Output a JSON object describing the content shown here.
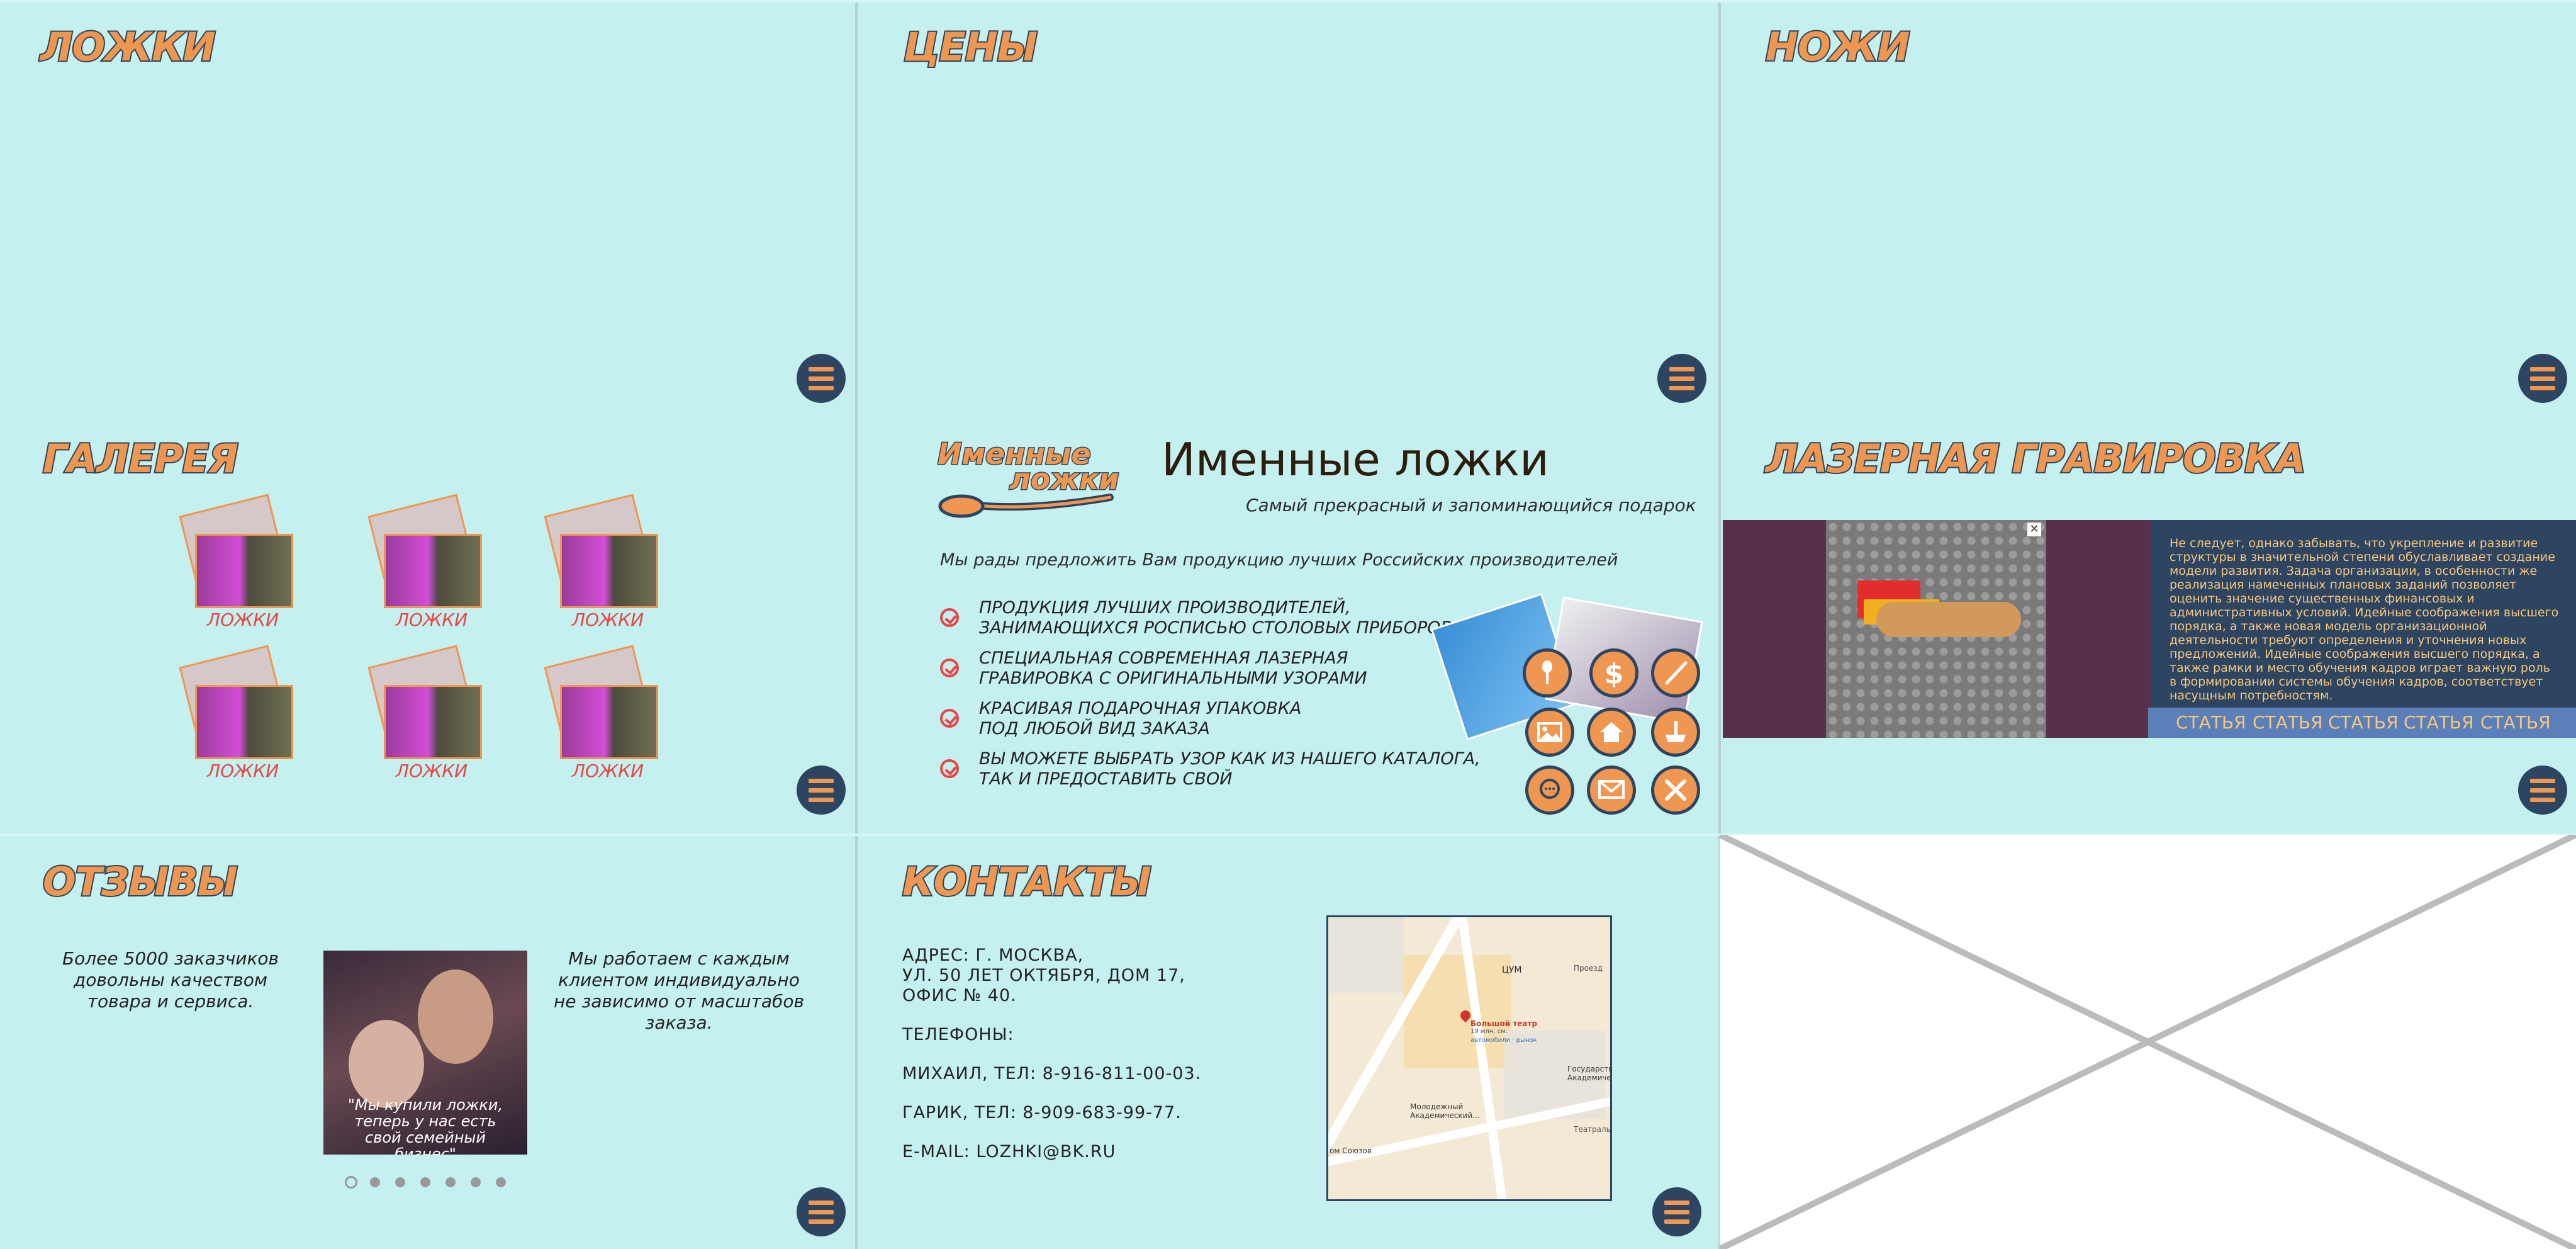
{
  "panels": {
    "spoons": {
      "title": "ЛОЖКИ"
    },
    "prices": {
      "title": "ЦЕНЫ"
    },
    "knives": {
      "title": "НОЖИ"
    },
    "gallery": {
      "title": "ГАЛЕРЕЯ",
      "items": [
        {
          "label": "ЛОЖКИ"
        },
        {
          "label": "ЛОЖКИ"
        },
        {
          "label": "ЛОЖКИ"
        },
        {
          "label": "ЛОЖКИ"
        },
        {
          "label": "ЛОЖКИ"
        },
        {
          "label": "ЛОЖКИ"
        }
      ]
    },
    "promo": {
      "logo_line1": "Именные",
      "logo_line2": "ложки",
      "heading": "Именные ложки",
      "subheading": "Самый прекрасный и запоминающийся подарок",
      "intro": "Мы рады предложить Вам продукцию лучших Российских производителей",
      "features": [
        {
          "line1": "ПРОДУКЦИЯ ЛУЧШИХ ПРОИЗВОДИТЕЛЕЙ,",
          "line2": "ЗАНИМАЮЩИХСЯ РОСПИСЬЮ СТОЛОВЫХ ПРИБОРОВ"
        },
        {
          "line1": "СПЕЦИАЛЬНАЯ СОВРЕМЕННАЯ ЛАЗЕРНАЯ",
          "line2": "ГРАВИРОВКА С ОРИГИНАЛЬНЫМИ УЗОРАМИ"
        },
        {
          "line1": "КРАСИВАЯ ПОДАРОЧНАЯ УПАКОВКА",
          "line2": "ПОД ЛЮБОЙ ВИД ЗАКАЗА"
        },
        {
          "line1": "ВЫ МОЖЕТЕ ВЫБРАТЬ УЗОР КАК ИЗ НАШЕГО КАТАЛОГА,",
          "line2": "ТАК И ПРЕДОСТАВИТЬ СВОЙ"
        }
      ],
      "icons": [
        "spoon-icon",
        "dollar-icon",
        "knife-icon",
        "gallery-icon",
        "home-icon",
        "engrave-icon",
        "chat-icon",
        "mail-icon",
        "close-icon"
      ]
    },
    "laser": {
      "title": "ЛАЗЕРНАЯ ГРАВИРОВКА",
      "text": "Не следует, однако забывать, что укрепление и развитие структуры в значительной степени обуславливает создание модели развития. Задача организации, в особенности же реализация намеченных плановых заданий позволяет оценить значение существенных финансовых и административных условий. Идейные соображения высшего порядка, а также новая модель организационной деятельности требуют определения и уточнения новых предложений. Идейные соображения высшего порядка, а также рамки и место обучения кадров играет важную роль в формировании системы обучения кадров, соответствует насущным потребностям.",
      "tabs": [
        "СТАТЬЯ",
        "СТАТЬЯ",
        "СТАТЬЯ",
        "СТАТЬЯ",
        "СТАТЬЯ"
      ]
    },
    "reviews": {
      "title": "ОТЗЫВЫ",
      "left_text": "Более 5000 заказчиков довольны качеством товара и сервиса.",
      "right_text": "Мы работаем с каждым клиентом индивидуально не зависимо от масштабов заказа.",
      "quote": "\"Мы купили ложки, теперь у нас есть свой семейный бизнес\"",
      "slides_total": 7,
      "slides_active": 1
    },
    "contacts": {
      "title": "КОНТАКТЫ",
      "address_line1": "АДРЕС:   Г. МОСКВА,",
      "address_line2": "УЛ. 50 ЛЕТ ОКТЯБРЯ, ДОМ 17,",
      "address_line3": "ОФИС № 40.",
      "phones_label": "ТЕЛЕФОНЫ:",
      "phone1": "МИХАИЛ,  ТЕЛ:  8-916-811-00-03.",
      "phone2": "ГАРИК,  ТЕЛ:    8-909-683-99-77.",
      "email": "E-MAIL:   LOZHKI@BK.RU",
      "map": {
        "pin_title": "Большой театр",
        "pin_sub1": "19 млн. см.",
        "pin_sub2": "автомобили · рынок",
        "label_tsum": "ЦУМ",
        "label_mol1": "Молодежный",
        "label_mol2": "Академический...",
        "label_gos1": "Государстве",
        "label_gos2": "Академичес",
        "label_soyuz": "ом Союзов",
        "label_pr": "Проезд",
        "label_teatr": "Театраль"
      }
    }
  },
  "colors": {
    "bg": "#c5f0f0",
    "accent": "#ef9650",
    "navy": "#2d4560",
    "red": "#e84545"
  },
  "menu_icon": "hamburger-menu-icon"
}
